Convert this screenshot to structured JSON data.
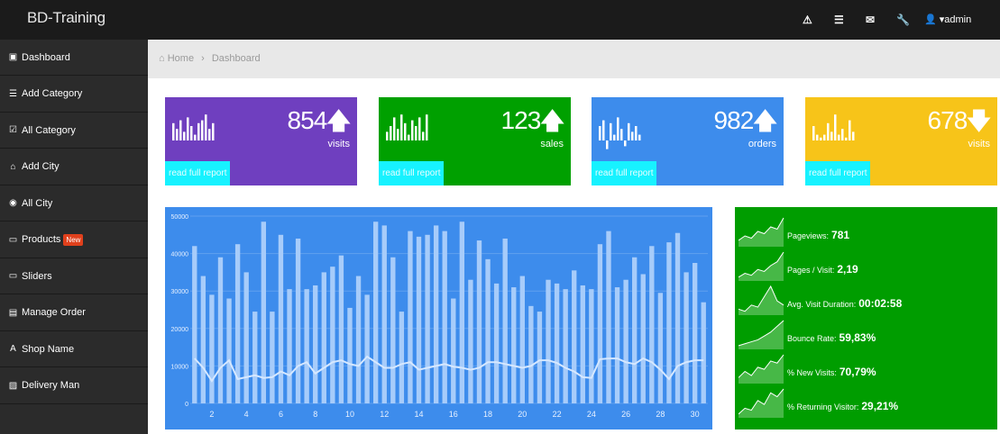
{
  "header": {
    "brand": "BD-Training",
    "icons": [
      "warning-icon",
      "list-icon",
      "envelope-icon",
      "wrench-icon"
    ],
    "user_label": "▾admin"
  },
  "sidebar": {
    "items": [
      {
        "label": "Dashboard",
        "icon": "dashboard-icon",
        "glyph": "▣"
      },
      {
        "label": "Add Category",
        "icon": "list-icon",
        "glyph": "☰"
      },
      {
        "label": "All Category",
        "icon": "checkbox-icon",
        "glyph": "☑"
      },
      {
        "label": "Add City",
        "icon": "building-icon",
        "glyph": "⌂"
      },
      {
        "label": "All City",
        "icon": "eye-icon",
        "glyph": "◉"
      },
      {
        "label": "Products",
        "icon": "folder-icon",
        "glyph": "▭",
        "badge": "New"
      },
      {
        "label": "Sliders",
        "icon": "folder-icon",
        "glyph": "▭"
      },
      {
        "label": "Manage Order",
        "icon": "table-icon",
        "glyph": "▤"
      },
      {
        "label": "Shop Name",
        "icon": "font-icon",
        "glyph": "A"
      },
      {
        "label": "Delivery Man",
        "icon": "image-icon",
        "glyph": "▨"
      }
    ]
  },
  "breadcrumb": {
    "home": "Home",
    "separator": "›",
    "current": "Dashboard"
  },
  "cards": [
    {
      "value": "854",
      "arrow": "🡅",
      "label": "visits",
      "report": "read full report",
      "color": "#6f3fbf",
      "trend": "up",
      "spark": [
        6,
        4,
        7,
        3,
        8,
        5,
        2,
        6,
        7,
        9,
        4,
        6
      ]
    },
    {
      "value": "123",
      "arrow": "🡅",
      "label": "sales",
      "report": "read full report",
      "color": "#00a000",
      "trend": "up",
      "spark": [
        3,
        5,
        8,
        4,
        9,
        6,
        2,
        7,
        5,
        8,
        3,
        9
      ]
    },
    {
      "value": "982",
      "arrow": "🡅",
      "label": "orders",
      "report": "read full report",
      "color": "#3d8cec",
      "trend": "up",
      "spark": [
        5,
        7,
        -3,
        6,
        2,
        8,
        4,
        -2,
        6,
        3,
        5,
        2
      ]
    },
    {
      "value": "678",
      "arrow": "🡇",
      "label": "visits",
      "report": "read full report",
      "color": "#f7c419",
      "trend": "down",
      "spark": [
        5,
        2,
        1,
        2,
        6,
        3,
        9,
        2,
        4,
        1,
        7,
        3
      ]
    }
  ],
  "chart_data": {
    "type": "bar",
    "y_ticks": [
      "50000",
      "40000",
      "30000",
      "20000",
      "10000",
      "0"
    ],
    "ylim": [
      0,
      50000
    ],
    "x_ticks": [
      "2",
      "4",
      "6",
      "8",
      "10",
      "12",
      "14",
      "16",
      "18",
      "20",
      "22",
      "24",
      "26",
      "28",
      "30"
    ],
    "bars": [
      42000,
      34000,
      29000,
      39000,
      28000,
      42500,
      35000,
      24500,
      48500,
      24500,
      45000,
      30500,
      44000,
      30500,
      31500,
      35000,
      36500,
      39500,
      25500,
      34000,
      29000,
      48500,
      47500,
      39000,
      24500,
      46000,
      44500,
      45000,
      47500,
      46000,
      28000,
      48500,
      33000,
      43500,
      38500,
      32000,
      44000,
      31000,
      34000,
      26000,
      24500,
      33000,
      32000,
      30500,
      35500,
      31500,
      30500,
      42500,
      46000,
      31000,
      33000,
      39000,
      34500,
      42000,
      29500,
      43000,
      45500,
      35000,
      37500,
      27000
    ],
    "line": [
      12000,
      9500,
      6000,
      9500,
      11500,
      6500,
      7000,
      7500,
      6800,
      7000,
      8500,
      7500,
      10000,
      11000,
      8000,
      9500,
      11000,
      11500,
      10500,
      10000,
      12500,
      11000,
      9500,
      9500,
      10500,
      11000,
      9000,
      9500,
      10000,
      10500,
      9800,
      9500,
      9000,
      9500,
      11000,
      11000,
      10500,
      10000,
      9500,
      10000,
      11500,
      11500,
      10800,
      9500,
      8500,
      7000,
      6800,
      11800,
      12000,
      12000,
      11000,
      10500,
      12000,
      11000,
      9000,
      6500,
      10000,
      11000,
      11500,
      11500
    ],
    "bar_color": "#a7ccfa",
    "line_color": "#d6e8ff"
  },
  "stats": [
    {
      "label": "Pageviews:",
      "value": "781",
      "spark": [
        2,
        4,
        3,
        6,
        5,
        8,
        7,
        12
      ]
    },
    {
      "label": "Pages / Visit:",
      "value": "2,19",
      "spark": [
        1,
        3,
        2,
        5,
        4,
        7,
        9,
        14
      ]
    },
    {
      "label": "Avg. Visit Duration:",
      "value": "00:02:58",
      "spark": [
        2,
        1,
        4,
        3,
        8,
        13,
        6,
        4
      ]
    },
    {
      "label": "Bounce Rate:",
      "value": "59,83%",
      "spark": [
        1,
        2,
        3,
        4,
        6,
        8,
        11,
        14
      ]
    },
    {
      "label": "% New Visits:",
      "value": "70,79%",
      "spark": [
        2,
        5,
        3,
        7,
        6,
        10,
        9,
        13
      ]
    },
    {
      "label": "% Returning Visitor:",
      "value": "29,21%",
      "spark": [
        1,
        4,
        3,
        8,
        6,
        12,
        10,
        14
      ]
    }
  ],
  "colors": {
    "topbar": "#1b1b1b",
    "sidebar": "#2b2b2b",
    "report_tab": "#17f2ff",
    "stats_bg": "#009d00"
  }
}
